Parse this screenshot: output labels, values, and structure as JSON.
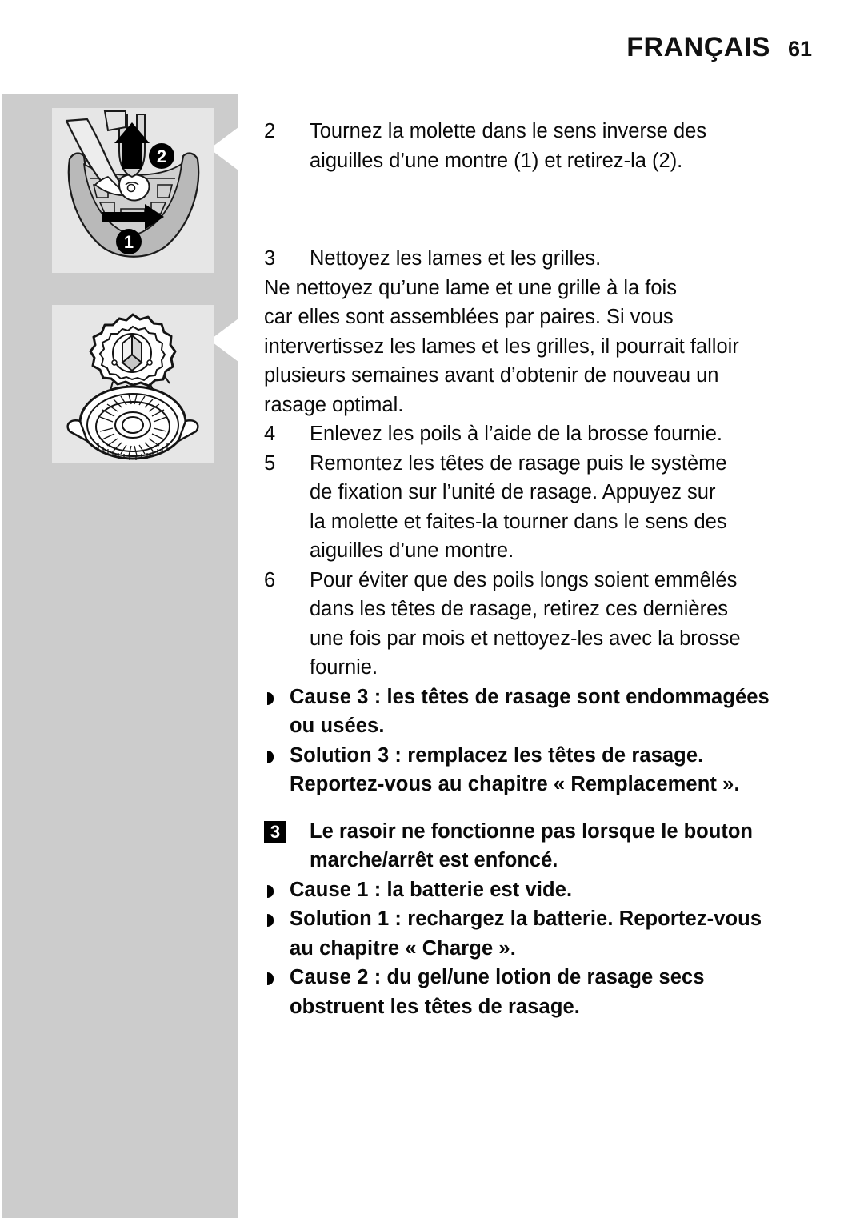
{
  "header": {
    "language": "FRANÇAIS",
    "page_number": "61"
  },
  "figures": [
    {
      "name": "shaver-retaining-ring-removal",
      "callouts": [
        "1",
        "2"
      ],
      "description": "Shaving unit held in hand: turn the retaining ring counter-clockwise (1) and lift it off (2)."
    },
    {
      "name": "cutter-and-guard-separated",
      "callouts": [],
      "description": "A shaving cutter shown above its matching guard/grille."
    }
  ],
  "steps": [
    {
      "number": "2",
      "lines": [
        "Tournez la molette dans le sens inverse des",
        "aiguilles d’une montre (1) et retirez-la (2)."
      ]
    },
    {
      "number": "3",
      "lines": [
        "Nettoyez les lames et les grilles."
      ]
    }
  ],
  "note_paragraph": {
    "lines": [
      "Ne nettoyez qu’une lame et une grille à la fois",
      "car elles sont assemblées par paires. Si vous",
      "intervertissez les lames et les grilles, il pourrait falloir",
      "plusieurs semaines avant d’obtenir de nouveau un",
      "rasage optimal."
    ]
  },
  "steps_cont": [
    {
      "number": "4",
      "lines": [
        "Enlevez les poils à l’aide de la brosse fournie."
      ]
    },
    {
      "number": "5",
      "lines": [
        "Remontez les têtes de rasage puis le système",
        "de fixation sur l’unité de rasage. Appuyez sur",
        "la molette et faites-la tourner dans le sens des",
        "aiguilles d’une montre."
      ]
    },
    {
      "number": "6",
      "lines": [
        "Pour éviter que des poils longs soient emmêlés",
        "dans les têtes de rasage, retirez ces dernières",
        "une fois par mois et nettoyez-les avec la brosse",
        "fournie."
      ]
    }
  ],
  "bullets_group_1": [
    {
      "marker": "half-disc-bullet",
      "lines": [
        "Cause 3 : les têtes de rasage sont endommagées",
        "ou usées."
      ]
    },
    {
      "marker": "half-disc-bullet",
      "lines": [
        "Solution 3 : remplacez les têtes de rasage.",
        "Reportez-vous au chapitre « Remplacement »."
      ]
    }
  ],
  "numbered_section": {
    "badge": "3",
    "lines": [
      "Le rasoir ne fonctionne pas lorsque le bouton",
      "marche/arrêt est enfoncé."
    ]
  },
  "bullets_group_2": [
    {
      "marker": "half-disc-bullet",
      "lines": [
        "Cause 1 : la batterie est vide."
      ]
    },
    {
      "marker": "half-disc-bullet",
      "lines": [
        "Solution 1 : rechargez la batterie. Reportez-vous",
        "au chapitre « Charge »."
      ]
    },
    {
      "marker": "half-disc-bullet",
      "lines": [
        "Cause  2 : du gel/une lotion de rasage secs",
        "obstruent les têtes de rasage."
      ]
    }
  ],
  "colors": {
    "page_background": "#ffffff",
    "figure_strip": "#cccccc",
    "figure_panel": "#e6e6e6",
    "text": "#0a0a0a",
    "badge_background": "#000000",
    "badge_text": "#ffffff"
  }
}
